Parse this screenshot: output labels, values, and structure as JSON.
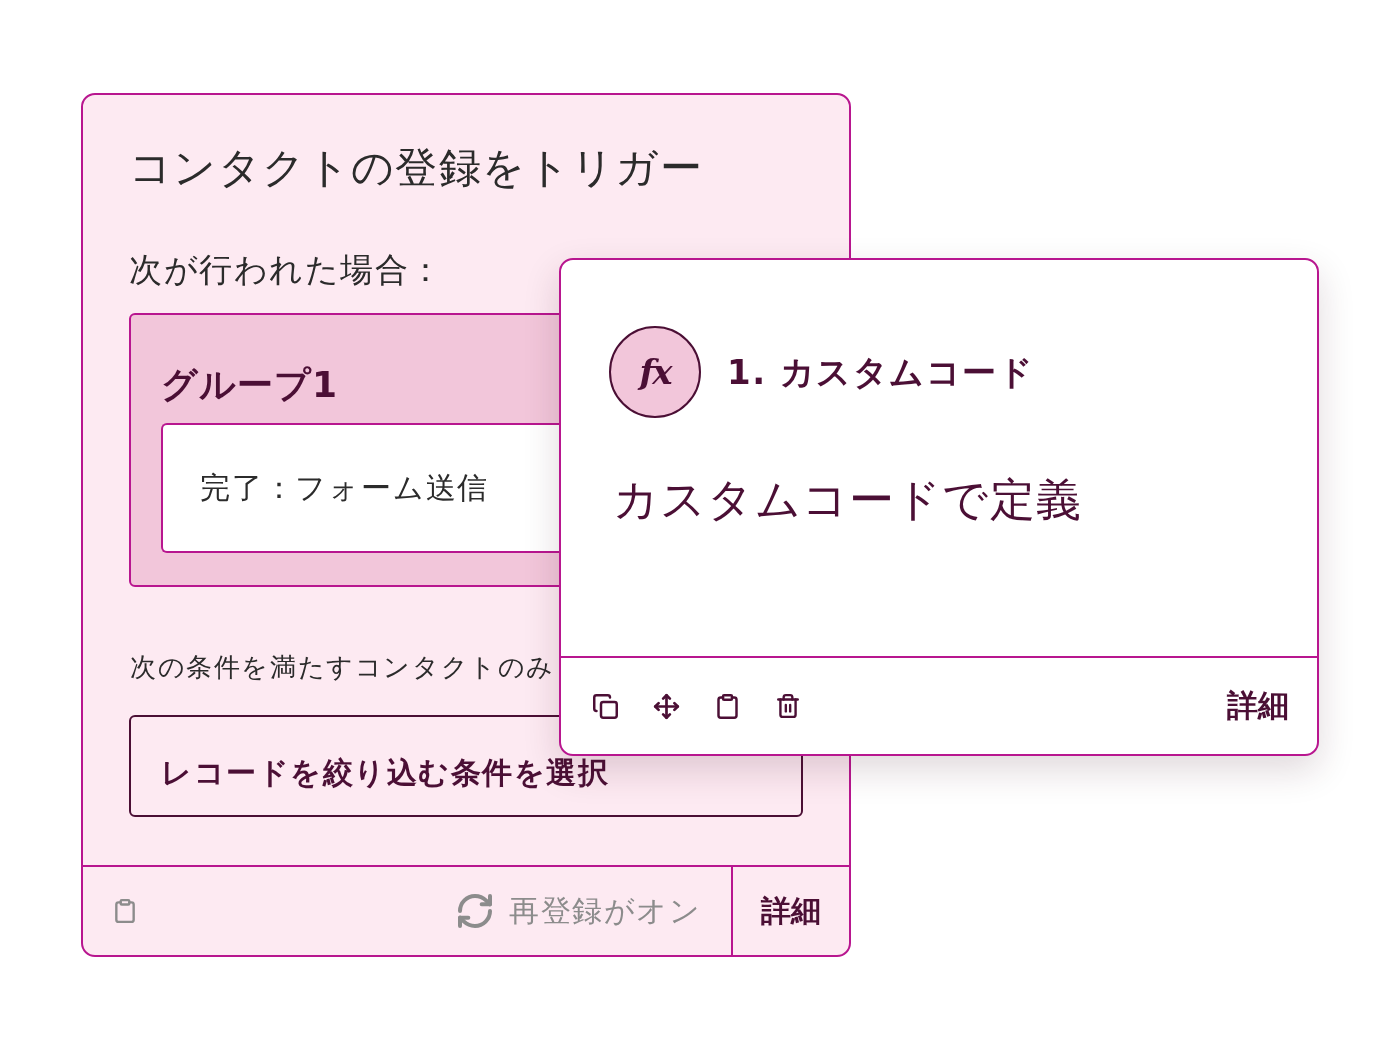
{
  "trigger_card": {
    "title": "コンタクトの登録をトリガー",
    "condition_heading": "次が行われた場合：",
    "group": {
      "title": "グループ1",
      "criteria": [
        "完了：フォーム送信"
      ]
    },
    "filter_label": "次の条件を満たすコンタクトのみ",
    "filter_button": "レコードを絞り込む条件を選択",
    "footer": {
      "reenrollment_status": "再登録がオン",
      "details_button": "詳細"
    }
  },
  "action_card": {
    "badge": "fx",
    "title": "1. カスタムコード",
    "description": "カスタムコードで定義",
    "details_button": "詳細"
  }
}
